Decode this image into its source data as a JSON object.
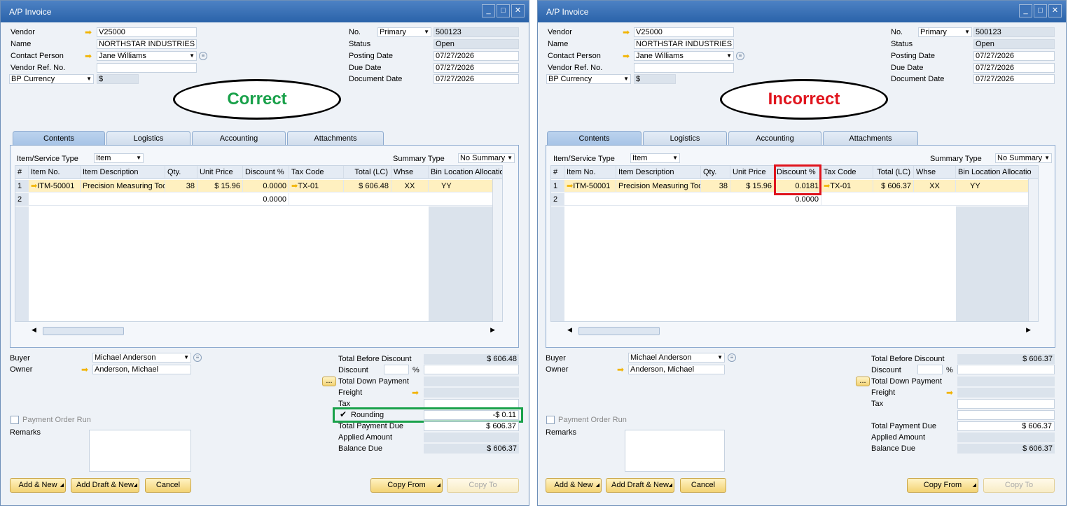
{
  "window_title": "A/P Invoice",
  "header": {
    "vendor_label": "Vendor",
    "vendor_value": "V25000",
    "name_label": "Name",
    "name_value": "NORTHSTAR INDUSTRIES LLC",
    "contact_label": "Contact Person",
    "contact_value": "Jane Williams",
    "vendor_ref_label": "Vendor Ref. No.",
    "vendor_ref_value": "",
    "currency_label": "BP Currency",
    "currency_value": "$",
    "no_label": "No.",
    "series_value": "Primary",
    "no_value": "500123",
    "status_label": "Status",
    "status_value": "Open",
    "posting_date_label": "Posting Date",
    "posting_date_value": "07/27/2026",
    "due_date_label": "Due Date",
    "due_date_value": "07/27/2026",
    "document_date_label": "Document Date",
    "document_date_value": "07/27/2026"
  },
  "annotations": {
    "correct": "Correct",
    "incorrect": "Incorrect"
  },
  "tabs": [
    "Contents",
    "Logistics",
    "Accounting",
    "Attachments"
  ],
  "contents": {
    "item_type_label": "Item/Service Type",
    "item_type_value": "Item",
    "summary_type_label": "Summary Type",
    "summary_type_value": "No Summary",
    "columns": [
      "#",
      "Item No.",
      "Item Description",
      "Qty.",
      "Unit Price",
      "Discount %",
      "Tax Code",
      "Total (LC)",
      "Whse",
      "Bin Location Allocatio"
    ]
  },
  "left_rows": [
    {
      "n": "1",
      "item": "ITM-50001",
      "desc": "Precision Measuring Tool",
      "qty": "38",
      "price": "$ 15.96",
      "disc": "0.0000",
      "tax": "TX-01",
      "total": "$ 606.48",
      "whse": "XX",
      "bin": "YY"
    },
    {
      "n": "2",
      "item": "",
      "desc": "",
      "qty": "",
      "price": "",
      "disc": "0.0000",
      "tax": "",
      "total": "",
      "whse": "",
      "bin": ""
    }
  ],
  "right_rows": [
    {
      "n": "1",
      "item": "ITM-50001",
      "desc": "Precision Measuring Too",
      "qty": "38",
      "price": "$ 15.96",
      "disc": "0.0181",
      "tax": "TX-01",
      "total": "$ 606.37",
      "whse": "XX",
      "bin": "YY"
    },
    {
      "n": "2",
      "item": "",
      "desc": "",
      "qty": "",
      "price": "",
      "disc": "0.0000",
      "tax": "",
      "total": "",
      "whse": "",
      "bin": ""
    }
  ],
  "footer": {
    "buyer_label": "Buyer",
    "buyer_value": "Michael Anderson",
    "owner_label": "Owner",
    "owner_value": "Anderson, Michael",
    "payment_order_label": "Payment Order Run",
    "remarks_label": "Remarks",
    "total_before_discount_label": "Total Before Discount",
    "discount_label": "Discount",
    "percent": "%",
    "down_payment_label": "Total Down Payment",
    "freight_label": "Freight",
    "tax_label": "Tax",
    "rounding_label": "Rounding",
    "total_payment_due_label": "Total Payment Due",
    "applied_amount_label": "Applied Amount",
    "balance_due_label": "Balance Due",
    "ellipsis": "..."
  },
  "left_totals": {
    "before_discount": "$ 606.48",
    "rounding": "-$ 0.11",
    "payment_due": "$ 606.37",
    "balance_due": "$ 606.37"
  },
  "right_totals": {
    "before_discount": "$ 606.37",
    "payment_due": "$ 606.37",
    "balance_due": "$ 606.37"
  },
  "buttons": {
    "add_new": "Add & New",
    "add_draft_new": "Add Draft & New",
    "cancel": "Cancel",
    "copy_from": "Copy From",
    "copy_to": "Copy To"
  },
  "colors": {
    "correct": "#19a14a",
    "incorrect": "#e0141d",
    "title_bar": "#2f68ad"
  }
}
